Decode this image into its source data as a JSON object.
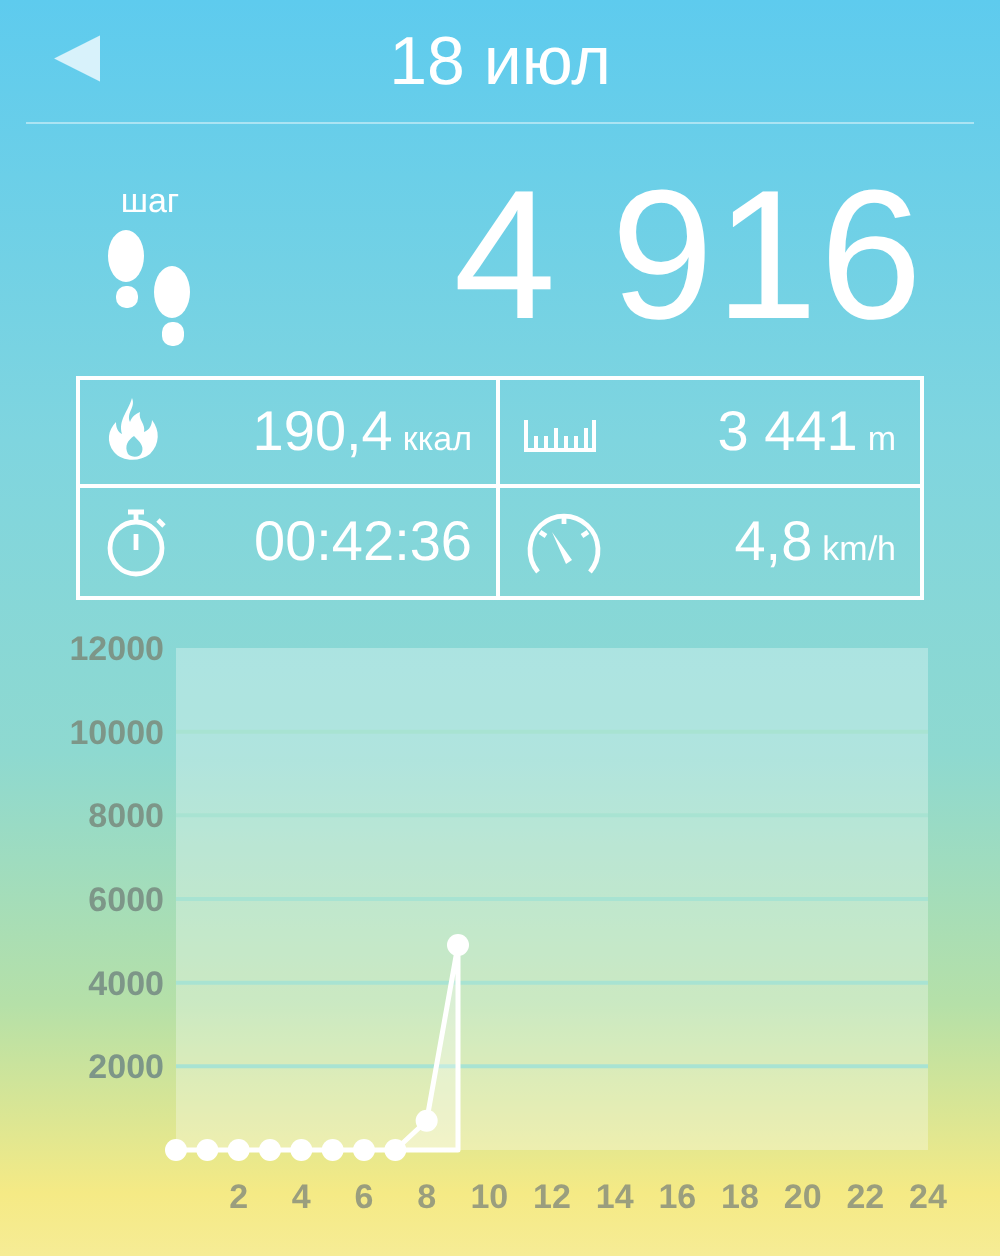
{
  "header": {
    "back": "◀",
    "title": "18 июл"
  },
  "steps": {
    "label": "шаг",
    "value": "4 916"
  },
  "stats": [
    {
      "value": "190,4",
      "unit": "ккал"
    },
    {
      "value": "3 441",
      "unit": "m"
    },
    {
      "value": "00:42:36"
    },
    {
      "value": "4,8",
      "unit": "km/h"
    }
  ],
  "chart": {
    "chart_data": {
      "type": "area",
      "x": [
        0,
        1,
        2,
        3,
        4,
        5,
        6,
        7,
        8,
        9
      ],
      "series": [
        {
          "color": "#ffffff",
          "values": [
            0,
            0,
            0,
            0,
            0,
            0,
            0,
            0,
            700,
            4900
          ]
        }
      ],
      "xlim": [
        0,
        24
      ],
      "ylim": [
        0,
        12000
      ],
      "xticks": [
        2,
        4,
        6,
        8,
        10,
        12,
        14,
        16,
        18,
        20,
        22,
        24
      ],
      "yticks": [
        2000,
        4000,
        6000,
        8000,
        10000,
        12000
      ],
      "grid": true
    }
  }
}
